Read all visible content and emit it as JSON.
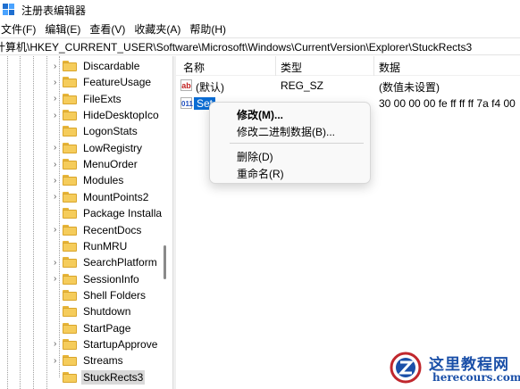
{
  "window": {
    "title": "注册表编辑器"
  },
  "menu": [
    "文件(F)",
    "编辑(E)",
    "查看(V)",
    "收藏夹(A)",
    "帮助(H)"
  ],
  "address": "计算机\\HKEY_CURRENT_USER\\Software\\Microsoft\\Windows\\CurrentVersion\\Explorer\\StuckRects3",
  "tree": {
    "items": [
      {
        "label": "Discardable",
        "expandable": true
      },
      {
        "label": "FeatureUsage",
        "expandable": true
      },
      {
        "label": "FileExts",
        "expandable": true
      },
      {
        "label": "HideDesktopIco",
        "expandable": true
      },
      {
        "label": "LogonStats",
        "expandable": false
      },
      {
        "label": "LowRegistry",
        "expandable": true
      },
      {
        "label": "MenuOrder",
        "expandable": true
      },
      {
        "label": "Modules",
        "expandable": true
      },
      {
        "label": "MountPoints2",
        "expandable": true
      },
      {
        "label": "Package Installa",
        "expandable": false
      },
      {
        "label": "RecentDocs",
        "expandable": true
      },
      {
        "label": "RunMRU",
        "expandable": false
      },
      {
        "label": "SearchPlatform",
        "expandable": true
      },
      {
        "label": "SessionInfo",
        "expandable": true
      },
      {
        "label": "Shell Folders",
        "expandable": false
      },
      {
        "label": "Shutdown",
        "expandable": false
      },
      {
        "label": "StartPage",
        "expandable": false
      },
      {
        "label": "StartupApprove",
        "expandable": true
      },
      {
        "label": "Streams",
        "expandable": true
      },
      {
        "label": "StuckRects3",
        "expandable": false,
        "selected": true
      }
    ]
  },
  "list": {
    "columns": [
      "名称",
      "类型",
      "数据"
    ],
    "rows": [
      {
        "icon": "string-value-icon",
        "icon_text": "ab",
        "name": "(默认)",
        "type": "REG_SZ",
        "data": "(数值未设置)"
      },
      {
        "icon": "binary-value-icon",
        "icon_text": "011",
        "name": "Set",
        "type": "",
        "data": "30 00 00 00 fe ff ff ff 7a f4 00"
      }
    ]
  },
  "context_menu": {
    "items": [
      "修改(M)...",
      "修改二进制数据(B)...",
      "删除(D)",
      "重命名(R)"
    ]
  },
  "watermark": {
    "title": "这里教程网",
    "url": "herecours.com"
  },
  "colors": {
    "selection": "#0a6cd3",
    "folder": "#f5cc5b",
    "watermark": "#1a4fa8"
  }
}
